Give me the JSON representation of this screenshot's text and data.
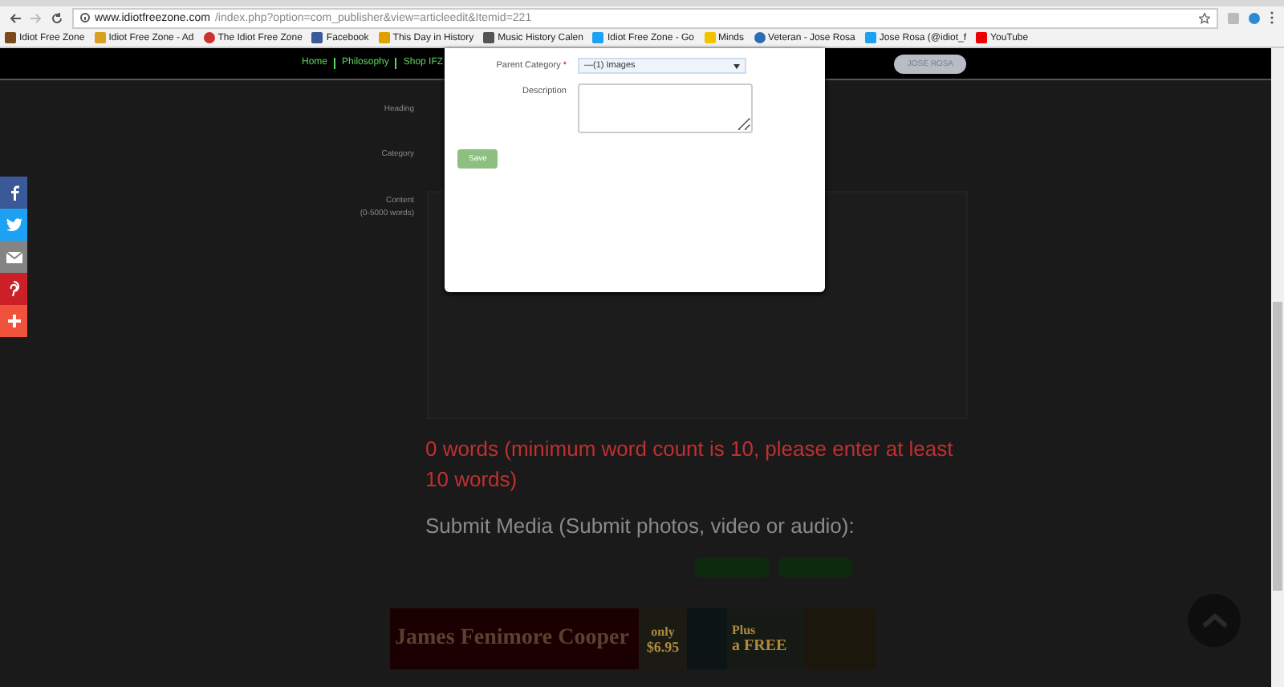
{
  "browser": {
    "url_host": "www.idiotfreezone.com",
    "url_path": "/index.php?option=com_publisher&view=articleedit&Itemid=221",
    "bookmarks": [
      {
        "label": "Idiot Free Zone",
        "kind": "box"
      },
      {
        "label": "Idiot Free Zone - Ad",
        "kind": "person"
      },
      {
        "label": "The Idiot Free Zone",
        "kind": "ring"
      },
      {
        "label": "Facebook",
        "kind": "facebook"
      },
      {
        "label": "This Day in History",
        "kind": "h"
      },
      {
        "label": "Music History Calen",
        "kind": "calendar"
      },
      {
        "label": "Idiot Free Zone - Go",
        "kind": "bird"
      },
      {
        "label": "Minds",
        "kind": "bulb"
      },
      {
        "label": "Veteran - Jose Rosa",
        "kind": "globe"
      },
      {
        "label": "Jose Rosa (@idiot_f",
        "kind": "bird"
      },
      {
        "label": "YouTube",
        "kind": "play"
      }
    ]
  },
  "nav": {
    "links": [
      "Home",
      "Philosophy",
      "Shop IFZ"
    ],
    "user_button": "JOSE ROSA"
  },
  "form": {
    "labels": [
      "Heading",
      "Category",
      "Content",
      "(0-5000 words)"
    ],
    "word_count_message": "0 words (minimum word count is 10, please enter at least 10 words)",
    "media_heading": "Submit Media (Submit photos, video or audio):"
  },
  "banner": {
    "title": "James Fenimore Cooper",
    "price_prefix": "only",
    "price": "$6.95",
    "bonus_prefix": "Plus",
    "bonus": "a FREE"
  },
  "share": [
    {
      "kind": "facebook",
      "color": "#3b5998"
    },
    {
      "kind": "twitter",
      "color": "#1da1f2"
    },
    {
      "kind": "email",
      "color": "#848484"
    },
    {
      "kind": "pinterest",
      "color": "#cb2027"
    },
    {
      "kind": "more",
      "color": "#f0523c"
    }
  ],
  "modal": {
    "parent_label": "Parent Category",
    "required_mark": "*",
    "parent_value": "—(1) Images",
    "description_label": "Description",
    "save": "Save"
  }
}
